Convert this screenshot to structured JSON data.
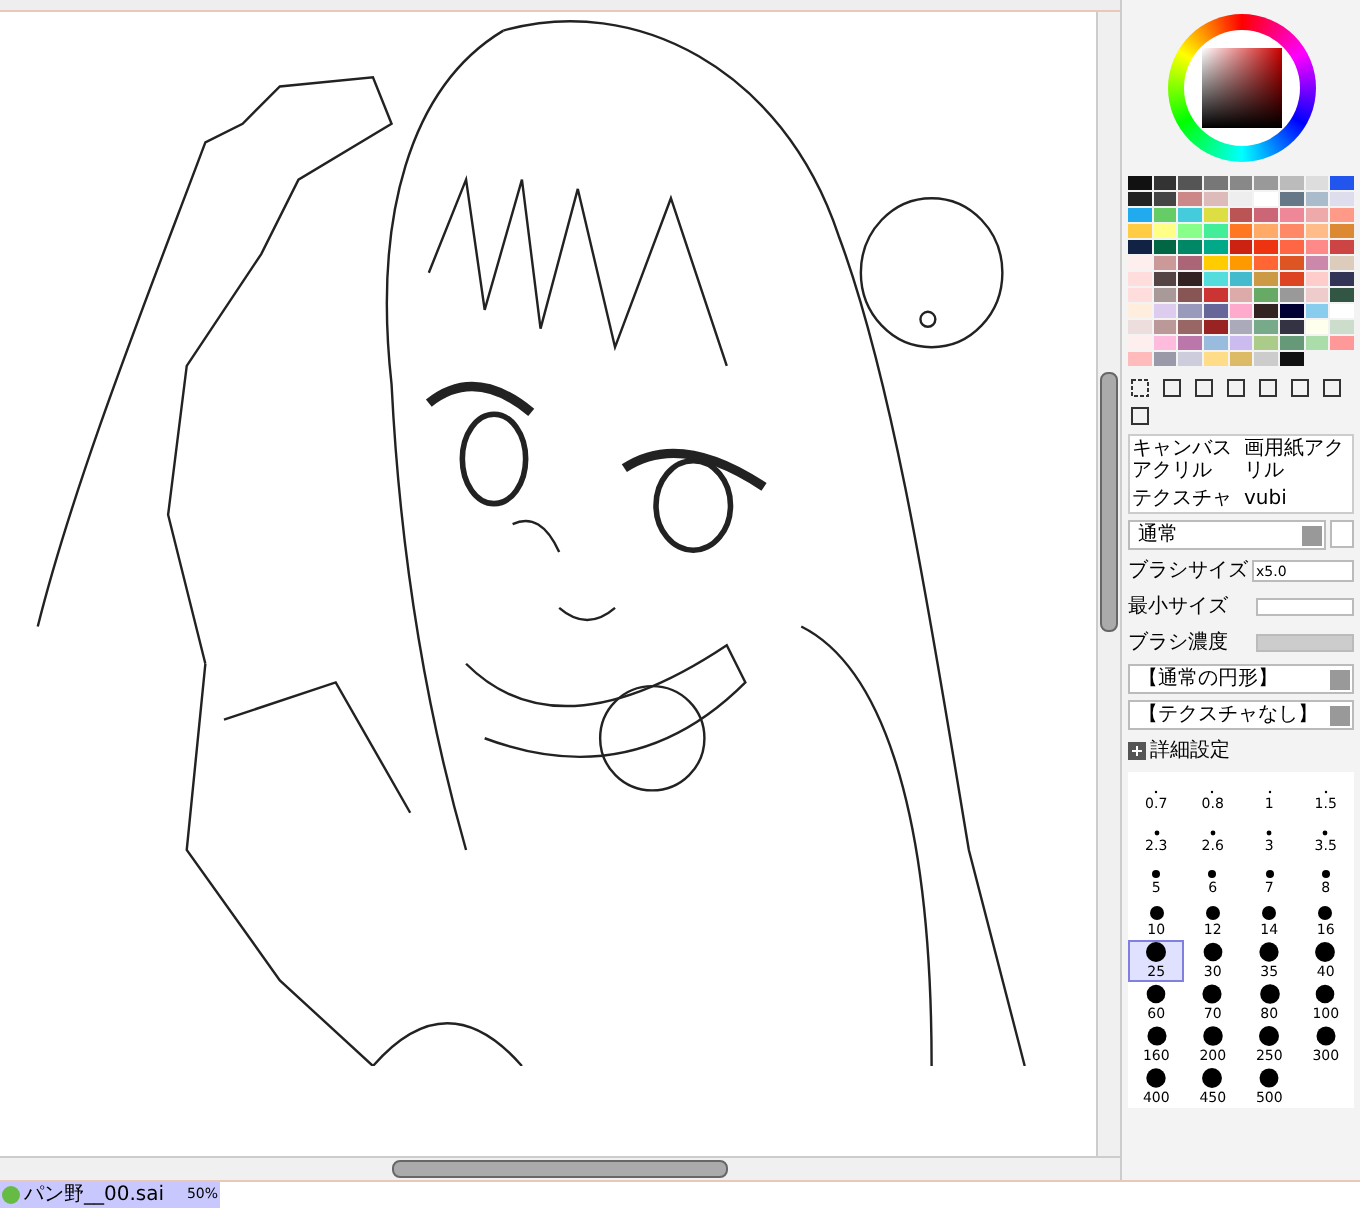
{
  "brush_slots": [
    {
      "label": "キャンバスアクリル"
    },
    {
      "label": "画用紙アクリル"
    },
    {
      "label": "テクスチャ"
    },
    {
      "label": "vubi"
    }
  ],
  "blend_mode": {
    "value": "通常"
  },
  "brush_size": {
    "label": "ブラシサイズ",
    "value": "x5.0"
  },
  "min_size": {
    "label": "最小サイズ",
    "level": 0
  },
  "density": {
    "label": "ブラシ濃度",
    "level": 1
  },
  "shape_select": {
    "value": "【通常の円形】"
  },
  "texture_select": {
    "value": "【テクスチャなし】"
  },
  "advanced": {
    "label": "詳細設定",
    "expanded": false
  },
  "brush_sizes": [
    {
      "label": "0.7",
      "selected": false
    },
    {
      "label": "0.8",
      "selected": false
    },
    {
      "label": "1",
      "selected": false
    },
    {
      "label": "1.5",
      "selected": false
    },
    {
      "label": "2.3",
      "selected": false
    },
    {
      "label": "2.6",
      "selected": false
    },
    {
      "label": "3",
      "selected": false
    },
    {
      "label": "3.5",
      "selected": false
    },
    {
      "label": "5",
      "selected": false
    },
    {
      "label": "6",
      "selected": false
    },
    {
      "label": "7",
      "selected": false
    },
    {
      "label": "8",
      "selected": false
    },
    {
      "label": "10",
      "selected": false
    },
    {
      "label": "12",
      "selected": false
    },
    {
      "label": "14",
      "selected": false
    },
    {
      "label": "16",
      "selected": false
    },
    {
      "label": "25",
      "selected": true
    },
    {
      "label": "30",
      "selected": false
    },
    {
      "label": "35",
      "selected": false
    },
    {
      "label": "40",
      "selected": false
    },
    {
      "label": "60",
      "selected": false
    },
    {
      "label": "70",
      "selected": false
    },
    {
      "label": "80",
      "selected": false
    },
    {
      "label": "100",
      "selected": false
    },
    {
      "label": "160",
      "selected": false
    },
    {
      "label": "200",
      "selected": false
    },
    {
      "label": "250",
      "selected": false
    },
    {
      "label": "300",
      "selected": false
    },
    {
      "label": "400",
      "selected": false
    },
    {
      "label": "450",
      "selected": false
    },
    {
      "label": "500",
      "selected": false
    }
  ],
  "document_tab": {
    "name": "パン野__00.sai",
    "zoom": "50%",
    "selected": true
  }
}
